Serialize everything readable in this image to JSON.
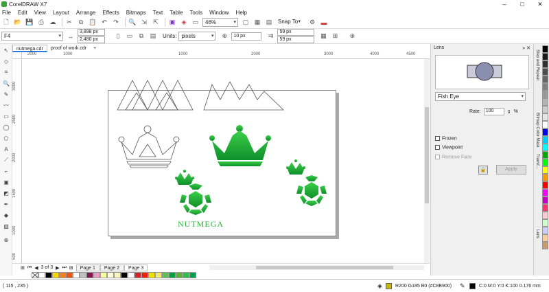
{
  "app": {
    "title": "CorelDRAW X7",
    "window_controls": [
      "–",
      "□",
      "✕"
    ]
  },
  "menu": [
    "File",
    "Edit",
    "View",
    "Layout",
    "Arrange",
    "Effects",
    "Bitmaps",
    "Text",
    "Table",
    "Tools",
    "Window",
    "Help"
  ],
  "standard_toolbar": {
    "zoom": "46%",
    "snap_to": "Snap To"
  },
  "property_bar": {
    "preset": "F4",
    "width": "3,898 px",
    "height": "2,480 px",
    "units_label": "Units:",
    "units_value": "pixels",
    "nudge": "10 px",
    "dup_x": "59 px",
    "dup_y": "59 px"
  },
  "document_tabs": [
    "nutmega.cdr",
    "proof of work.cdr"
  ],
  "ruler": {
    "unit_label": "pixels",
    "h_ticks": [
      "2000",
      "1000",
      "1000",
      "2000",
      "3000",
      "4000",
      "4500"
    ],
    "v_ticks": [
      "3000",
      "2500",
      "2000",
      "1500",
      "1000",
      "500"
    ]
  },
  "artwork": {
    "logo_text": "NUTMEGA",
    "logo_color": "#2bb53a"
  },
  "page_nav": {
    "counter": "3 of 3",
    "pages": [
      "Page 1",
      "Page 2",
      "Page 3"
    ]
  },
  "palette_colors": [
    "#ffffff",
    "#000000",
    "#f7d700",
    "#f08020",
    "#e35a1a",
    "#ffffff",
    "#c0c0c0",
    "#801850",
    "#e8a0c0",
    "#ffffa0",
    "#ffffe0",
    "#fff5c0",
    "#000000",
    "#ffffff",
    "#d02828",
    "#f02000",
    "#f0e000",
    "#f0e870",
    "#60c060",
    "#00a040",
    "#60b040",
    "#30c050",
    "#00a050"
  ],
  "right_palette": [
    "#000000",
    "#1a1a1a",
    "#333333",
    "#4d4d4d",
    "#666666",
    "#808080",
    "#999999",
    "#b3b3b3",
    "#cccccc",
    "#e6e6e6",
    "#ffffff",
    "#0000ff",
    "#00ccff",
    "#00ffff",
    "#00aa00",
    "#00ff00",
    "#ffff00",
    "#ff9900",
    "#ff0000",
    "#ff00ff",
    "#cc00cc",
    "#ff3366",
    "#ffcccc",
    "#ccffcc",
    "#ccccff",
    "#ffcc99",
    "#cc9966"
  ],
  "status": {
    "coords": "( 115 , 235 )",
    "fill": "R200 G185 B0 (#C8B900)",
    "outline": "C:0 M:0 Y:0 K:100  0.176 mm"
  },
  "lens_docker": {
    "title": "Lens",
    "effect": "Fish Eye",
    "rate_label": "Rate:",
    "rate_value": "100",
    "rate_unit": "%",
    "frozen_label": "Frozen",
    "viewpoint_label": "Viewpoint",
    "remove_face_label": "Remove Face",
    "apply_label": "Apply"
  },
  "side_tabs": [
    "Step and Repeat",
    "Bitmap Color Mask",
    "Transf...",
    "Lens"
  ]
}
